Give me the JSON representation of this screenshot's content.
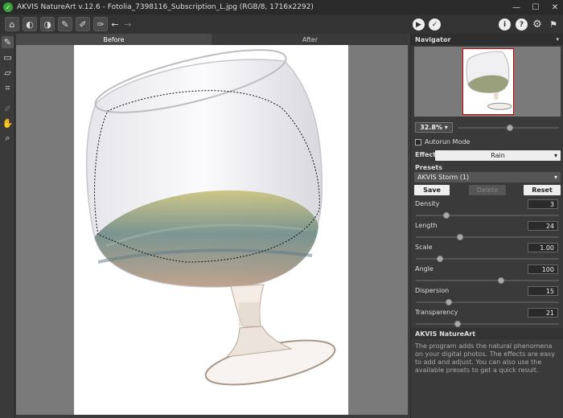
{
  "window": {
    "title": "AKVIS NatureArt v.12.6 - Fotolia_7398116_Subscription_L.jpg (RGB/8, 1716x2292)",
    "minimize": "—",
    "maximize": "☐",
    "close": "✕"
  },
  "tabs": {
    "before": "Before",
    "after": "After"
  },
  "navigator": {
    "title": "Navigator",
    "zoom": "32.8%",
    "zoom_fraction": 0.52
  },
  "autorun_label": "Autorun Mode",
  "effect": {
    "label": "Effect:",
    "value": "Rain"
  },
  "presets": {
    "label": "Presets",
    "value": "AKVIS Storm (1)",
    "save": "Save",
    "delete": "Delete",
    "reset": "Reset"
  },
  "params": [
    {
      "label": "Density",
      "value": "3",
      "fraction": 0.2
    },
    {
      "label": "Length",
      "value": "24",
      "fraction": 0.3
    },
    {
      "label": "Scale",
      "value": "1.00",
      "fraction": 0.15
    },
    {
      "label": "Angle",
      "value": "100",
      "fraction": 0.6
    },
    {
      "label": "Dispersion",
      "value": "15",
      "fraction": 0.22
    },
    {
      "label": "Transparency",
      "value": "21",
      "fraction": 0.28
    }
  ],
  "help": {
    "title": "AKVIS NatureArt",
    "text": "The program adds the natural phenomena on your digital photos. The effects are easy to add and adjust. You can also use the available presets to get a quick result."
  },
  "colors": {
    "accent": "#3aa33a",
    "panel": "#3a3a3a",
    "canvas_bg": "#7a7a7a"
  }
}
